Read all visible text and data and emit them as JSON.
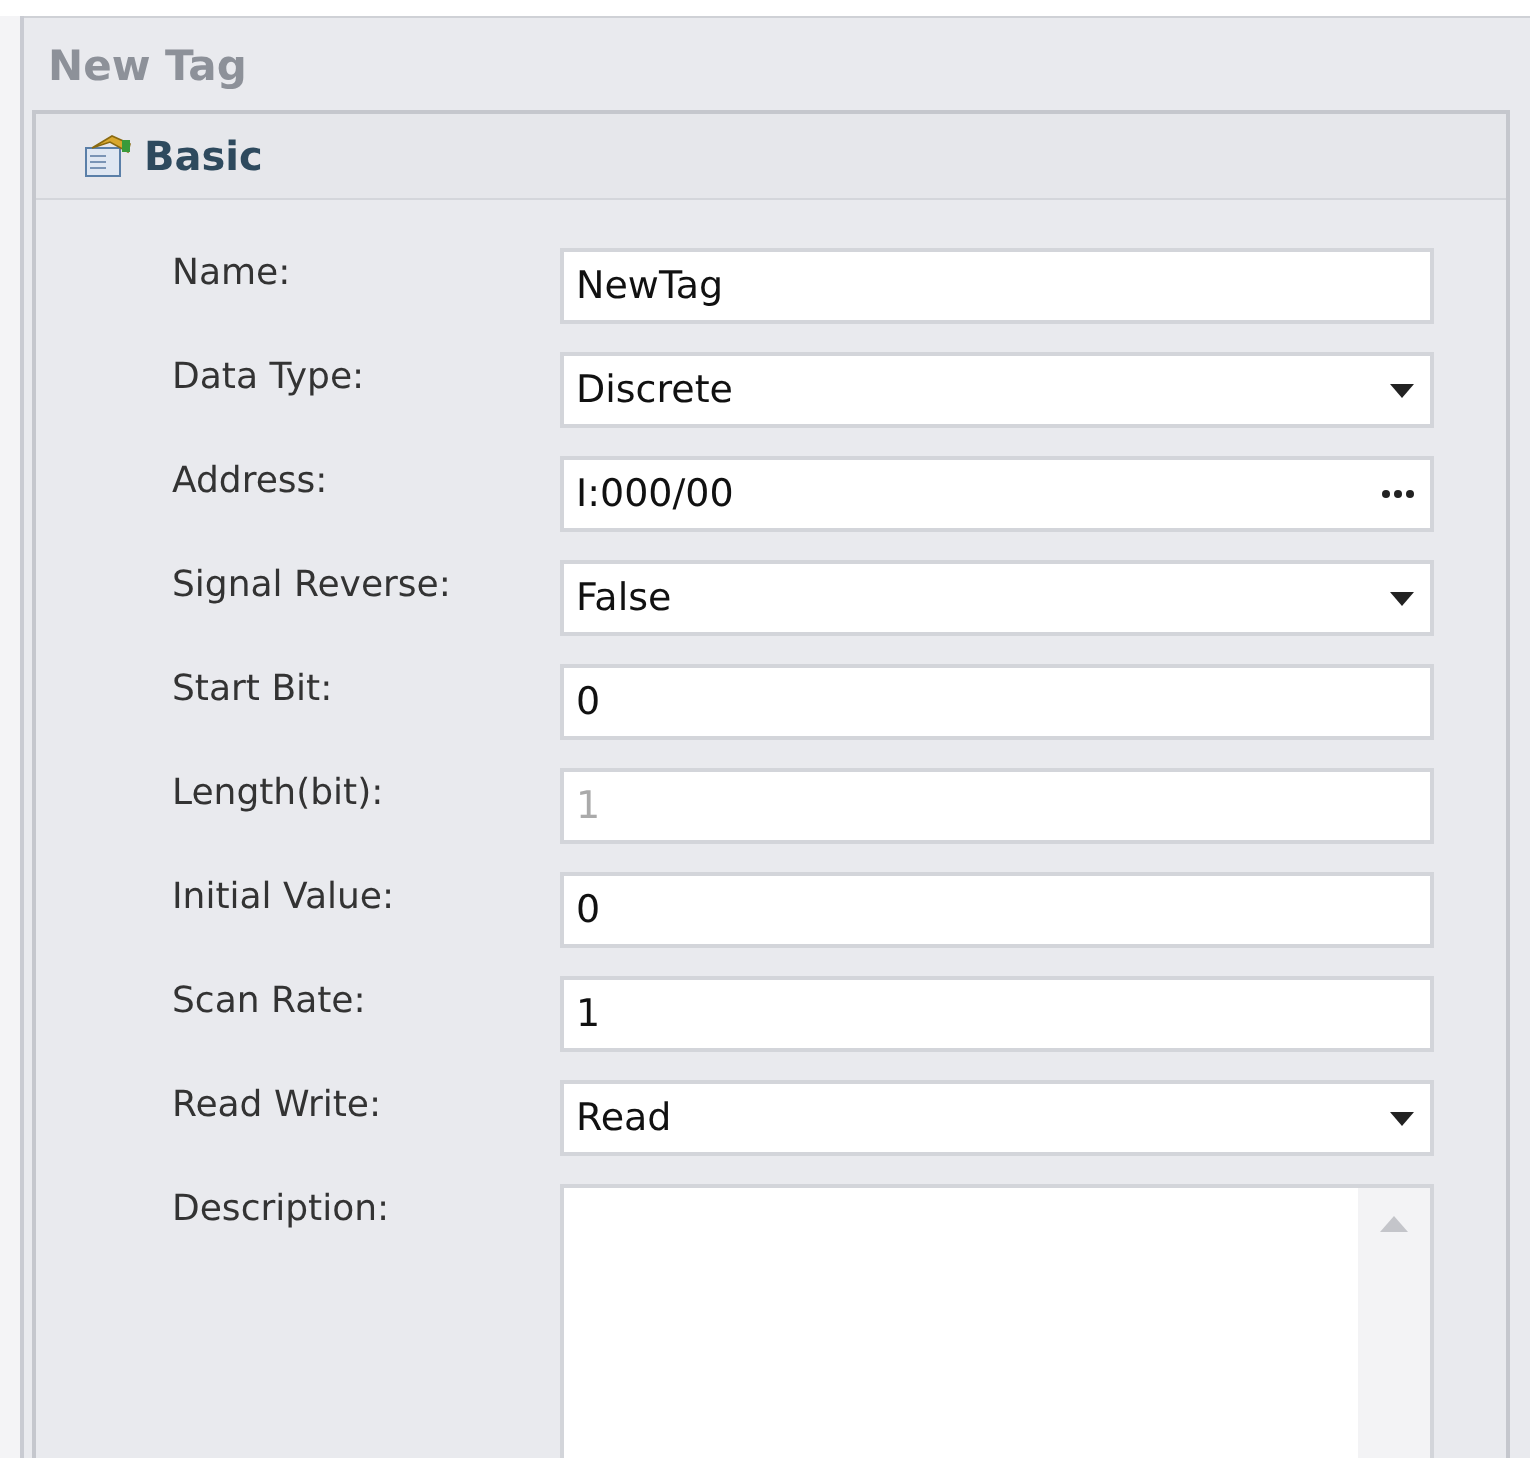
{
  "window": {
    "title": "New Tag"
  },
  "section": {
    "title": "Basic"
  },
  "fields": [
    {
      "label": "Name:",
      "kind": "text",
      "value": "NewTag",
      "disabled": false
    },
    {
      "label": "Data Type:",
      "kind": "dropdown",
      "value": "Discrete",
      "disabled": false
    },
    {
      "label": "Address:",
      "kind": "browse",
      "value": "I:000/00",
      "disabled": false
    },
    {
      "label": "Signal Reverse:",
      "kind": "dropdown",
      "value": "False",
      "disabled": false
    },
    {
      "label": "Start Bit:",
      "kind": "text",
      "value": "0",
      "disabled": false
    },
    {
      "label": "Length(bit):",
      "kind": "text",
      "value": "1",
      "disabled": true
    },
    {
      "label": "Initial Value:",
      "kind": "text",
      "value": "0",
      "disabled": false
    },
    {
      "label": "Scan Rate:",
      "kind": "text",
      "value": "1",
      "disabled": false
    },
    {
      "label": "Read Write:",
      "kind": "dropdown",
      "value": "Read",
      "disabled": false
    },
    {
      "label": "Description:",
      "kind": "multiline",
      "disabled": false
    }
  ]
}
